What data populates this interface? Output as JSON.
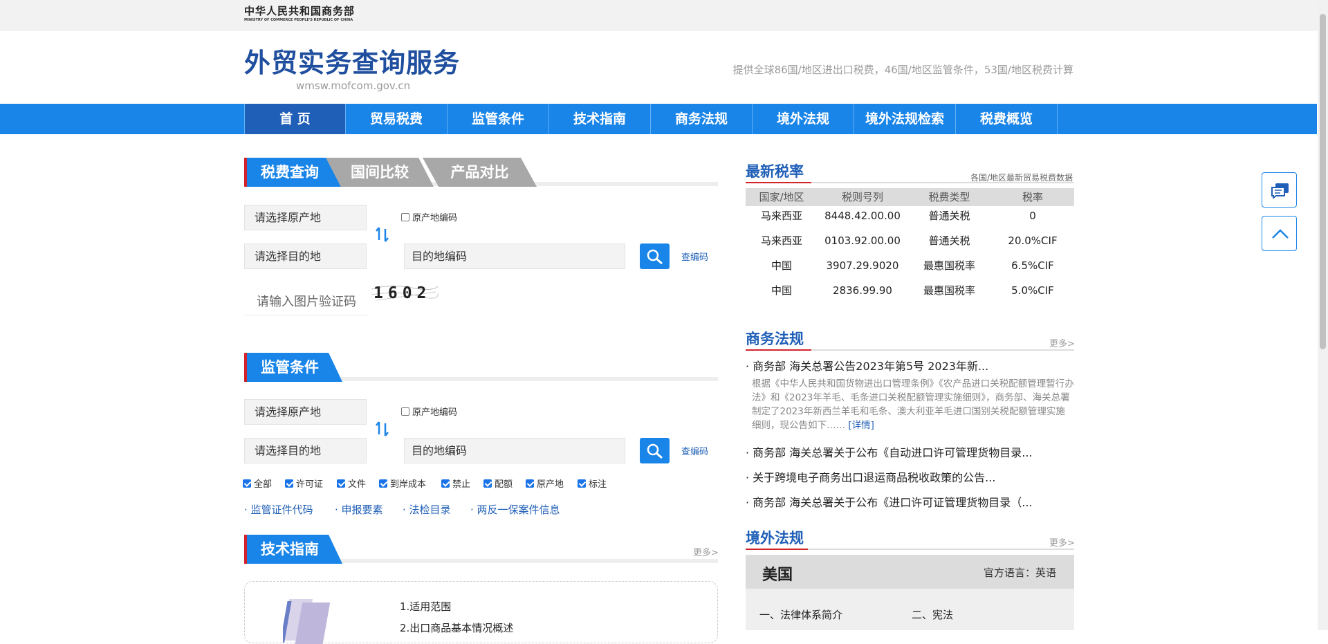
{
  "header": {
    "ministry_cn": "中华人民共和国商务部",
    "ministry_en": "MINISTRY OF COMMERCE PEOPLE'S REPUBLIC OF CHINA",
    "title": "外贸实务查询服务",
    "url": "wmsw.mofcom.gov.cn",
    "desc": "提供全球86国/地区进出口税费，46国/地区监管条件，53国/地区税费计算"
  },
  "nav": [
    "首 页",
    "贸易税费",
    "监管条件",
    "技术指南",
    "商务法规",
    "境外法规",
    "境外法规检索",
    "税费概览"
  ],
  "tax": {
    "tabs": [
      "税费查询",
      "国间比较",
      "产品对比"
    ],
    "origin_placeholder": "请选择原产地",
    "origin_code_label": "原产地编码",
    "dest_placeholder": "请选择目的地",
    "dest_code_placeholder": "目的地编码",
    "lookup_code": "查编码",
    "captcha_placeholder": "请输入图片验证码",
    "captcha_text": "1602"
  },
  "supervision": {
    "title": "监管条件",
    "origin_placeholder": "请选择原产地",
    "origin_code_label": "原产地编码",
    "dest_placeholder": "请选择目的地",
    "dest_code_placeholder": "目的地编码",
    "lookup_code": "查编码",
    "checks": [
      "全部",
      "许可证",
      "文件",
      "到岸成本",
      "禁止",
      "配额",
      "原产地",
      "标注"
    ],
    "links": [
      "监管证件代码",
      "申报要素",
      "法检目录",
      "两反一保案件信息"
    ]
  },
  "guide": {
    "title": "技术指南",
    "more": "更多>",
    "items": [
      "1.适用范围",
      "2.出口商品基本情况概述"
    ]
  },
  "rates": {
    "title": "最新税率",
    "subtitle": "各国/地区最新贸易税费数据",
    "headers": [
      "国家/地区",
      "税则号列",
      "税费类型",
      "税率"
    ],
    "rows": [
      [
        "马来西亚",
        "8448.42.00.00",
        "普通关税",
        "0"
      ],
      [
        "马来西亚",
        "0103.92.00.00",
        "普通关税",
        "20.0%CIF"
      ],
      [
        "中国",
        "3907.29.9020",
        "最惠国税率",
        "6.5%CIF"
      ],
      [
        "中国",
        "2836.99.90",
        "最惠国税率",
        "5.0%CIF"
      ]
    ]
  },
  "regulations": {
    "title": "商务法规",
    "more": "更多>",
    "items": [
      "商务部 海关总署公告2023年第5号 2023年新...",
      "商务部 海关总署关于公布《自动进口许可管理货物目录...",
      "关于跨境电子商务出口退运商品税收政策的公告...",
      "商务部 海关总署关于公布《进口许可证管理货物目录（..."
    ],
    "summary": "根据《中华人民共和国货物进出口管理条例》《农产品进口关税配额管理暂行办法》和《2023年羊毛、毛条进口关税配额管理实施细则》，商务部、海关总署制定了2023年新西兰羊毛和毛条、澳大利亚羊毛进口国别关税配额管理实施细则，现公告如下……",
    "detail": "[详情]"
  },
  "foreign": {
    "title": "境外法规",
    "more": "更多>",
    "country": "美国",
    "language": "官方语言：英语",
    "sections": [
      "一、法律体系简介",
      "二、宪法"
    ]
  },
  "colors": {
    "primary": "#1a85e8",
    "dark_blue": "#1f5fb7",
    "accent_red": "#d2232a"
  }
}
